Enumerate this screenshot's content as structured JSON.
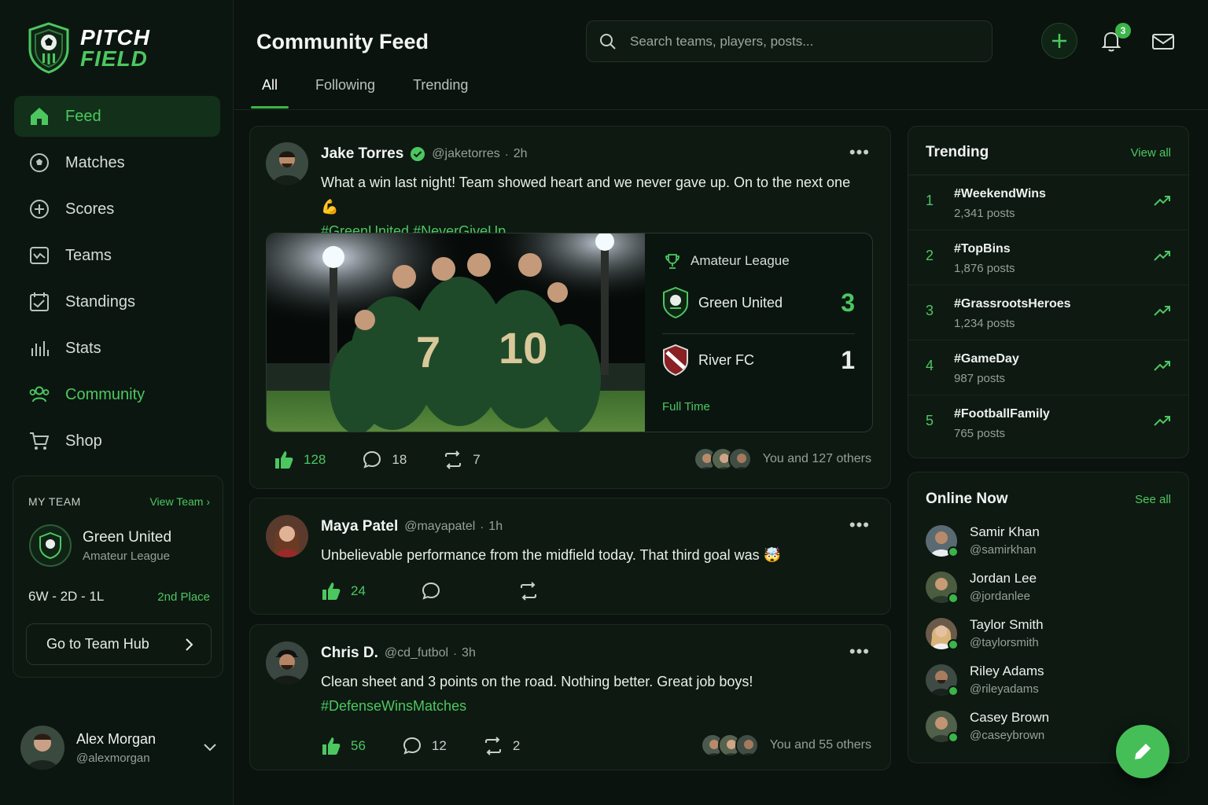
{
  "brand": {
    "line1": "PITCH",
    "line2": "FIELD"
  },
  "nav": [
    {
      "label": "Feed",
      "icon": "home-icon"
    },
    {
      "label": "Matches",
      "icon": "soccer-ball-icon"
    },
    {
      "label": "Scores",
      "icon": "plus-circle-icon"
    },
    {
      "label": "Teams",
      "icon": "chart-box-icon"
    },
    {
      "label": "Standings",
      "icon": "calendar-check-icon"
    },
    {
      "label": "Stats",
      "icon": "bar-stats-icon"
    },
    {
      "label": "Community",
      "icon": "users-icon"
    },
    {
      "label": "Shop",
      "icon": "cart-icon"
    }
  ],
  "my_team": {
    "title": "MY TEAM",
    "view_link": "View Team",
    "name": "Green United",
    "league": "Amateur League",
    "record": "6W - 2D - 1L",
    "place": "2nd Place",
    "hub_button": "Go to Team Hub"
  },
  "user": {
    "name": "Alex Morgan",
    "handle": "@alexmorgan"
  },
  "header": {
    "title": "Community Feed",
    "search_placeholder": "Search teams, players, posts...",
    "notification_count": "3",
    "tabs": [
      "All",
      "Following",
      "Trending"
    ]
  },
  "posts": [
    {
      "name": "Jake Torres",
      "handle": "@jaketorres",
      "time": "2h",
      "text": "What a win last night! Team showed heart and we never gave up. On to the next one 💪",
      "tags": "#GreenUnited #NeverGiveUp",
      "likes": "128",
      "comments": "18",
      "reposts": "7",
      "reactors": "You and 127 others",
      "match": {
        "league": "Amateur League",
        "home": "Green United",
        "home_score": "3",
        "away": "River FC",
        "away_score": "1",
        "status": "Full Time"
      }
    },
    {
      "name": "Maya Patel",
      "handle": "@mayapatel",
      "time": "1h",
      "text": "Unbelievable performance from the midfield today. That third goal was 🤯",
      "likes": "24"
    },
    {
      "name": "Chris D.",
      "handle": "@cd_futbol",
      "time": "3h",
      "text": "Clean sheet and 3 points on the road. Nothing better. Great job boys!",
      "tags": "#DefenseWinsMatches",
      "likes": "56",
      "comments": "12",
      "reposts": "2",
      "reactors": "You and 55 others"
    }
  ],
  "trending": {
    "title": "Trending",
    "view_all": "View all",
    "items": [
      {
        "rank": "1",
        "tag": "#WeekendWins",
        "count": "2,341 posts"
      },
      {
        "rank": "2",
        "tag": "#TopBins",
        "count": "1,876 posts"
      },
      {
        "rank": "3",
        "tag": "#GrassrootsHeroes",
        "count": "1,234 posts"
      },
      {
        "rank": "4",
        "tag": "#GameDay",
        "count": "987 posts"
      },
      {
        "rank": "5",
        "tag": "#FootballFamily",
        "count": "765 posts"
      }
    ]
  },
  "online": {
    "title": "Online Now",
    "see_all": "See all",
    "users": [
      {
        "name": "Samir Khan",
        "handle": "@samirkhan"
      },
      {
        "name": "Jordan Lee",
        "handle": "@jordanlee"
      },
      {
        "name": "Taylor Smith",
        "handle": "@taylorsmith"
      },
      {
        "name": "Riley Adams",
        "handle": "@rileyadams"
      },
      {
        "name": "Casey Brown",
        "handle": "@caseybrown"
      }
    ]
  },
  "colors": {
    "accent": "#4cc760",
    "background": "#0a130d",
    "card": "#0e1912"
  }
}
